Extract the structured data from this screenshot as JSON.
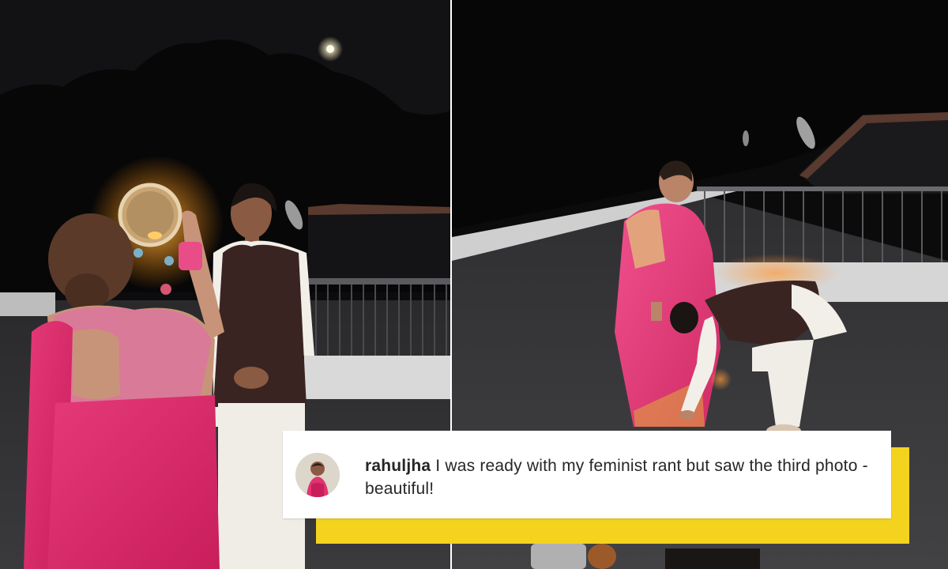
{
  "comment": {
    "username": "rahuljha",
    "text": "I was ready with my feminist rant but saw the third photo - beautiful!"
  },
  "images": {
    "left": "photo-couple-moon-ritual",
    "right": "photo-touching-feet"
  },
  "icons": {
    "avatar": "user-avatar"
  },
  "colors": {
    "highlight": "#f4d31f",
    "card": "#ffffff",
    "saree_pink": "#e0346f",
    "text": "#262626"
  }
}
